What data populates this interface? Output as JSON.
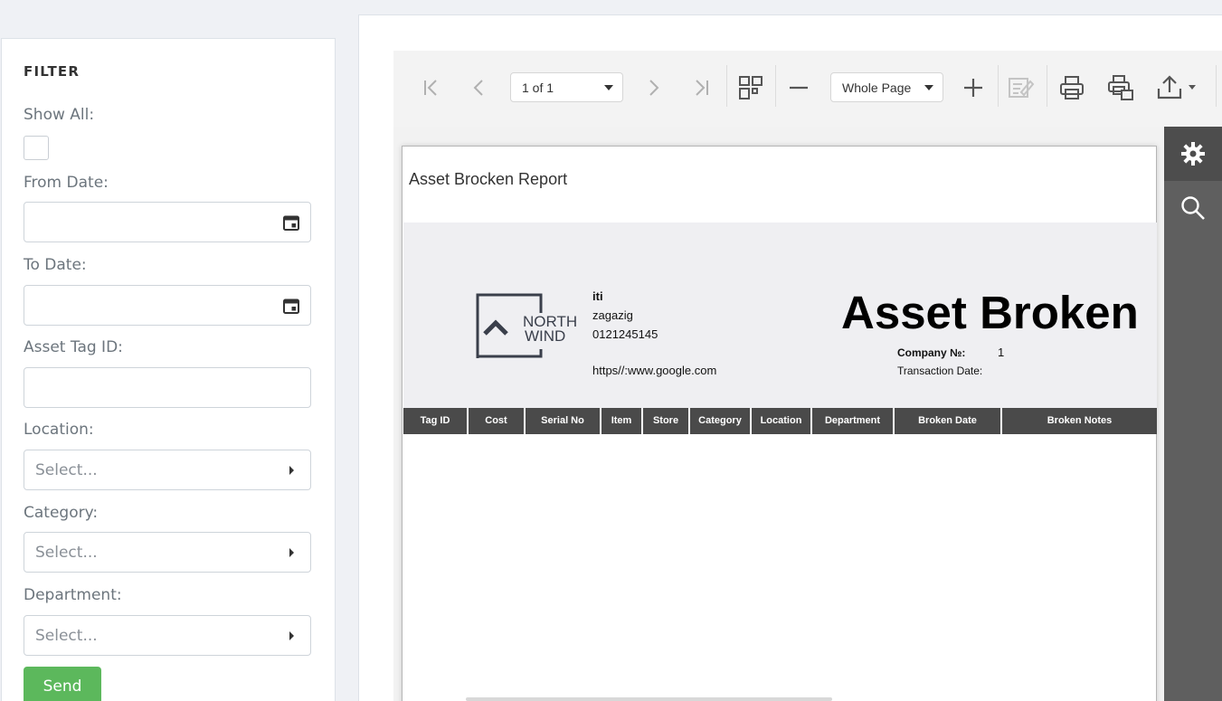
{
  "filter": {
    "title": "FILTER",
    "show_all_label": "Show All:",
    "from_date_label": "From Date:",
    "to_date_label": "To Date:",
    "asset_tag_label": "Asset Tag ID:",
    "location_label": "Location:",
    "location_placeholder": "Select...",
    "category_label": "Category:",
    "category_placeholder": "Select...",
    "department_label": "Department:",
    "department_placeholder": "Select...",
    "send_label": "Send"
  },
  "toolbar": {
    "page_selector": "1 of 1",
    "zoom_selector": "Whole Page",
    "icons": [
      "first-page-icon",
      "prev-page-icon",
      "next-page-icon",
      "last-page-icon",
      "multipage-icon",
      "zoom-out-icon",
      "zoom-in-icon",
      "edit-fields-icon",
      "print-icon",
      "print-page-icon",
      "export-icon"
    ]
  },
  "side_panel": {
    "icons": [
      "gear-icon",
      "search-icon"
    ]
  },
  "report": {
    "title": "Asset Brocken Report",
    "logo_text_1": "NORTH",
    "logo_text_2": "WIND",
    "company_name": "iti",
    "company_city": "zagazig",
    "company_phone": "0121245145",
    "company_url": "https//:www.google.com",
    "heading": "Asset Broken",
    "company_no_label": "Company №:",
    "company_no_value": "1",
    "transaction_date_label": "Transaction Date:",
    "columns": [
      "Tag ID",
      "Cost",
      "Serial No",
      "Item",
      "Store",
      "Category",
      "Location",
      "Department",
      "Broken Date",
      "Broken Notes"
    ]
  },
  "colors": {
    "send_button": "#5cb85c",
    "table_header": "#4a4a4a",
    "side_panel": "#5f5f5f"
  }
}
